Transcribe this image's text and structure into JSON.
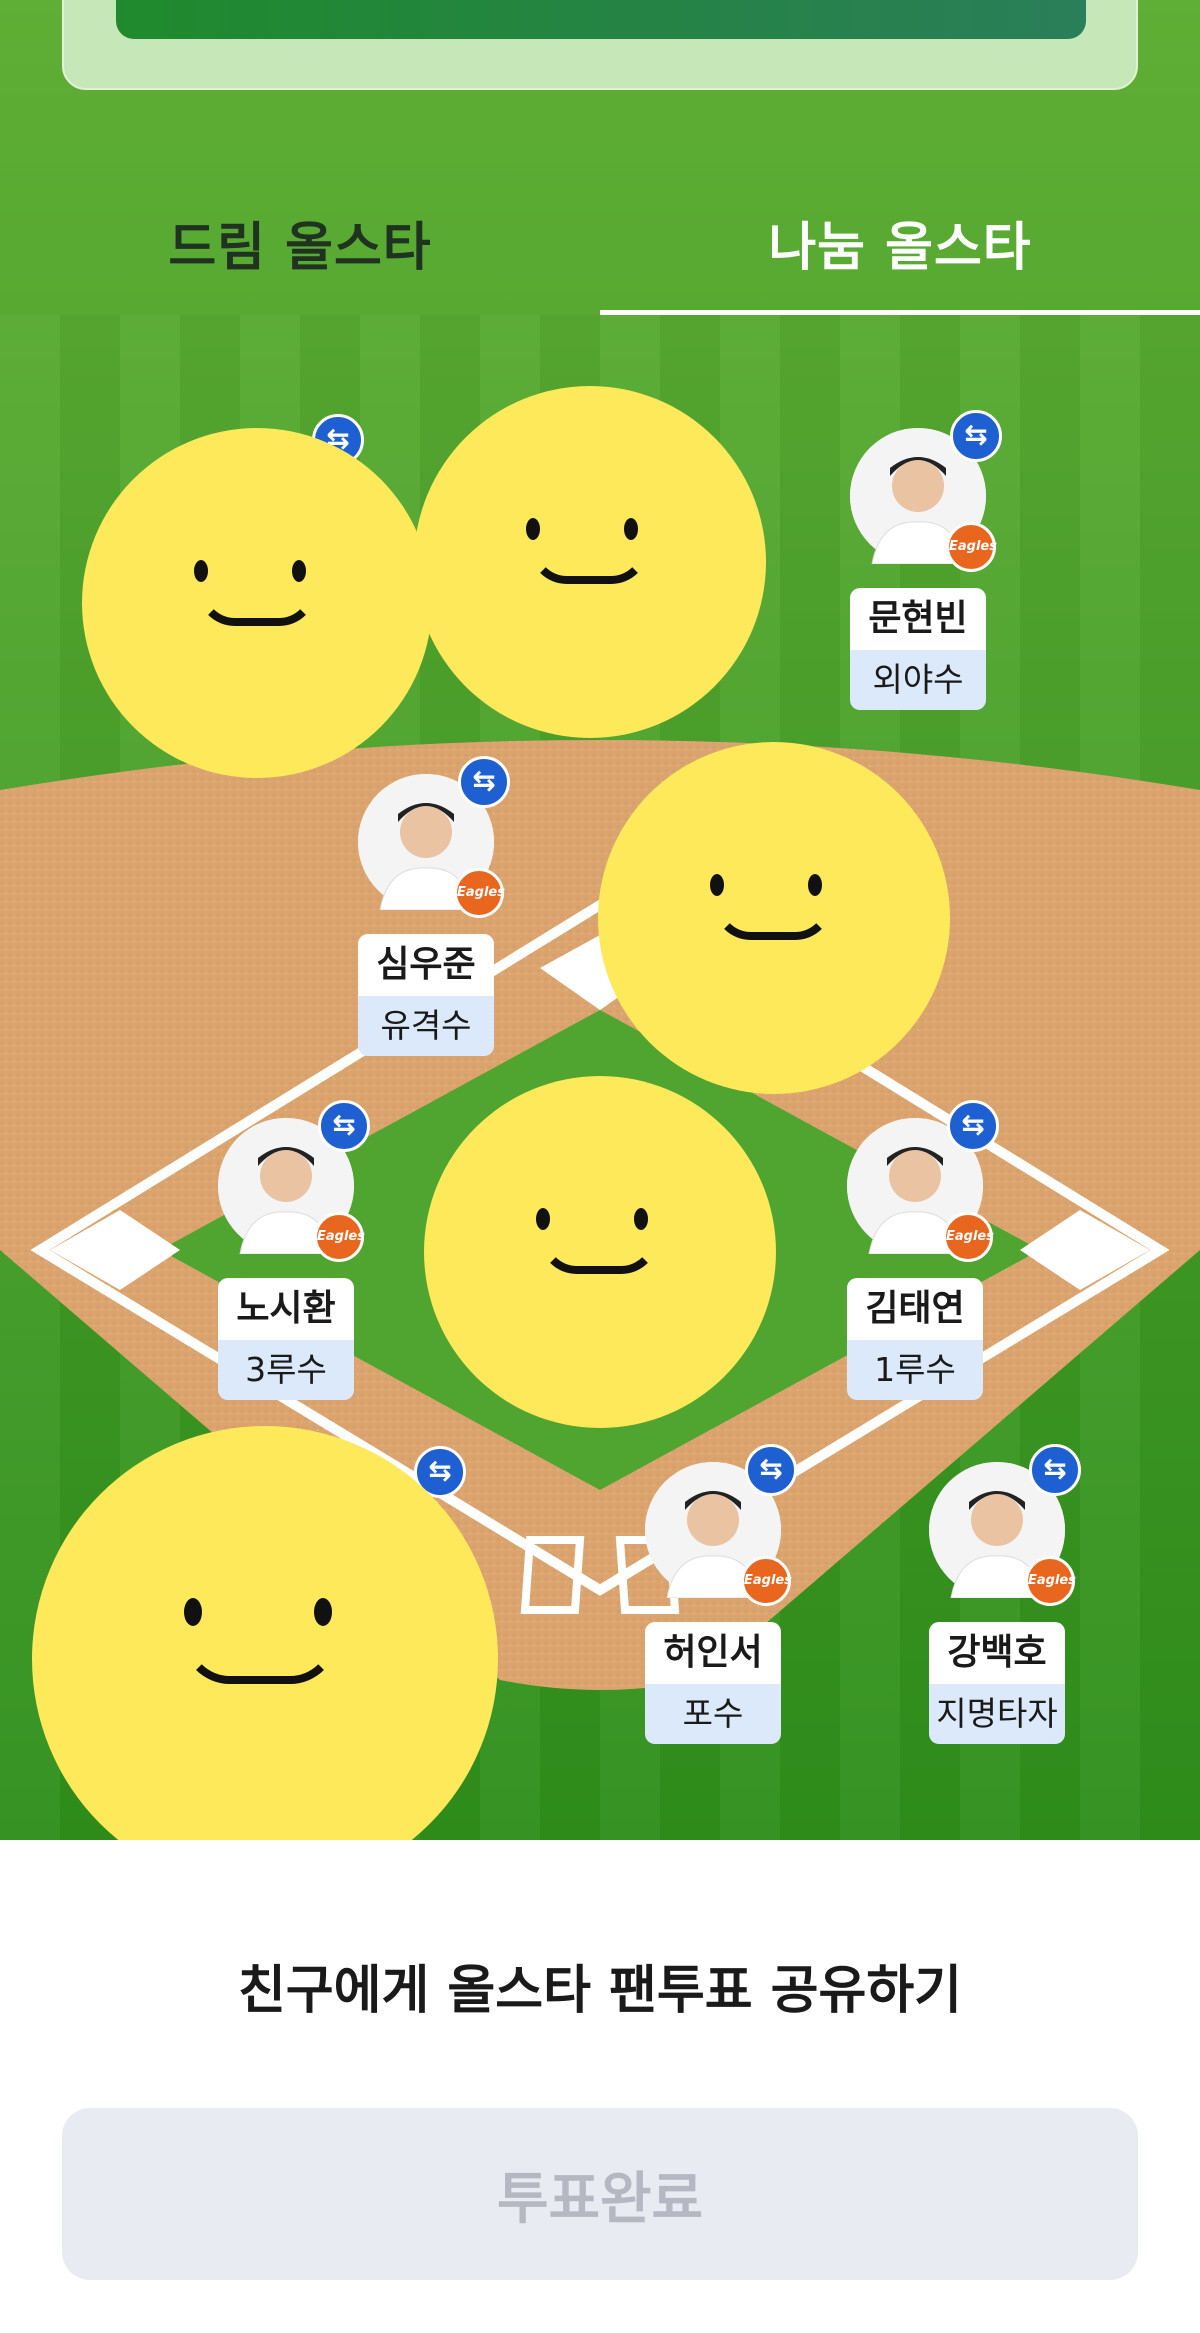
{
  "tabs": [
    {
      "label": "드림 올스타",
      "active": false
    },
    {
      "label": "나눔 올스타",
      "active": true
    }
  ],
  "players": [
    {
      "name": "문현빈",
      "position": "외야수"
    },
    {
      "name": "심우준",
      "position": "유격수"
    },
    {
      "name": "노시환",
      "position": "3루수"
    },
    {
      "name": "김태연",
      "position": "1루수"
    },
    {
      "name": "허인서",
      "position": "포수"
    },
    {
      "name": "강백호",
      "position": "지명타자"
    }
  ],
  "icons": {
    "swap": "⇆",
    "team_logo": "Eagles"
  },
  "share_label": "친구에게 올스타 팬투표 공유하기",
  "vote_button_label": "투표완료",
  "colors": {
    "accent_blue": "#1e5fd1",
    "team_orange": "#e8661d",
    "field_green": "#4aa12a",
    "infield_dirt": "#dba46e",
    "emoji_yellow": "#fde95a"
  }
}
